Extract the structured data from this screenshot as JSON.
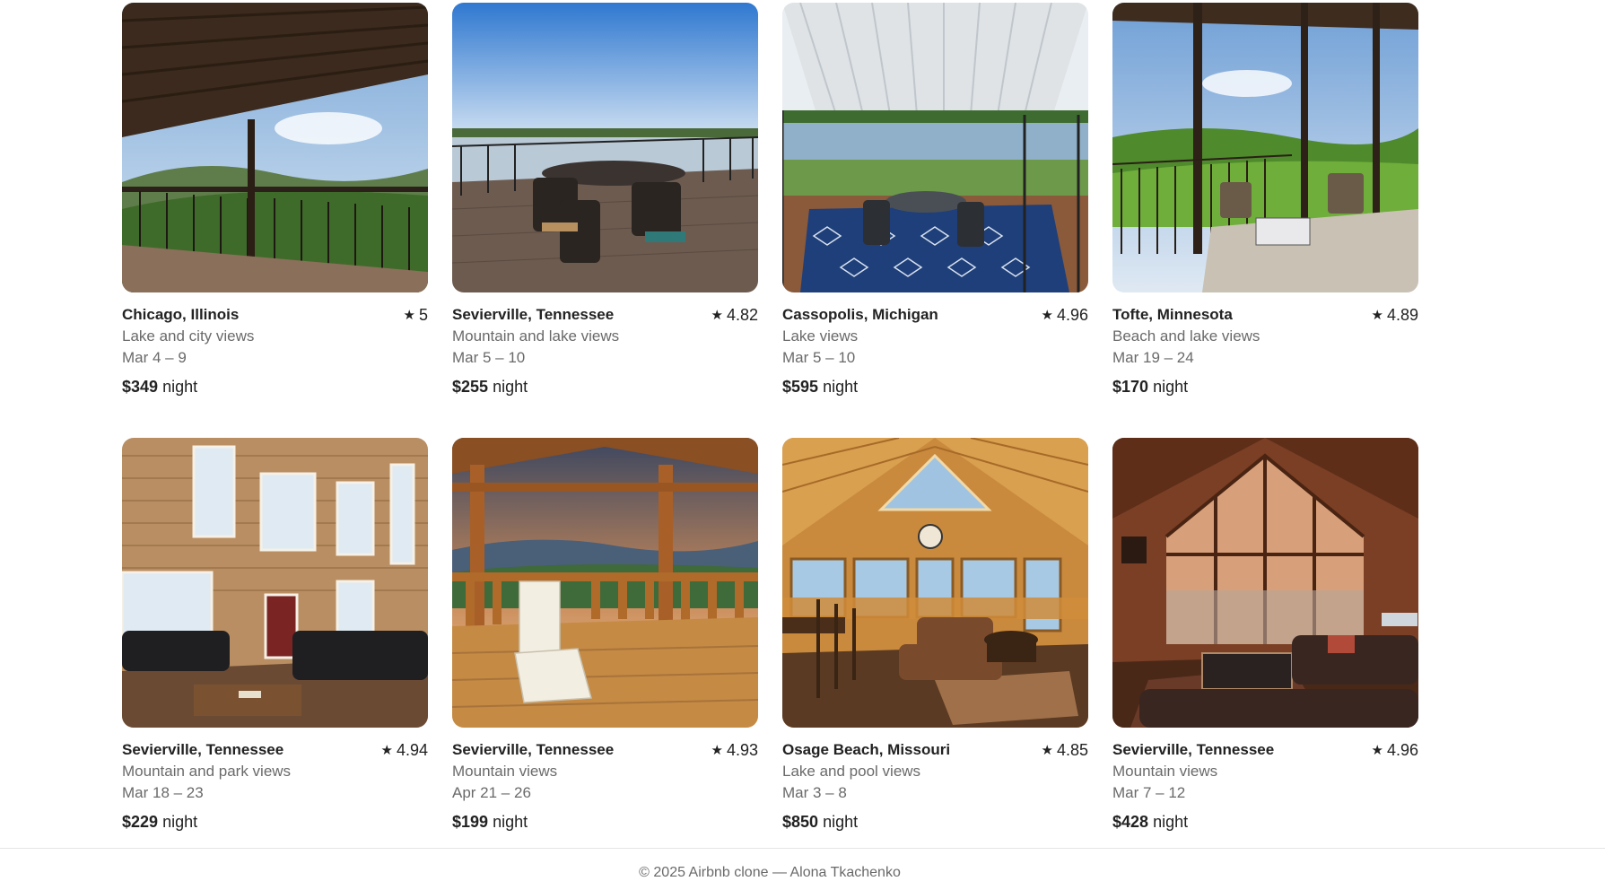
{
  "listings": [
    {
      "location": "Chicago, Illinois",
      "rating": "5",
      "subtitle": "Lake and city views",
      "dates": "Mar 4 – 9",
      "price": "$349",
      "unit": "night",
      "scene": "deck-mountain"
    },
    {
      "location": "Sevierville, Tennessee",
      "rating": "4.82",
      "subtitle": "Mountain and lake views",
      "dates": "Mar 5 – 10",
      "price": "$255",
      "unit": "night",
      "scene": "deck-lake"
    },
    {
      "location": "Cassopolis, Michigan",
      "rating": "4.96",
      "subtitle": "Lake views",
      "dates": "Mar 5 – 10",
      "price": "$595",
      "unit": "night",
      "scene": "porch-lake"
    },
    {
      "location": "Tofte, Minnesota",
      "rating": "4.89",
      "subtitle": "Beach and lake views",
      "dates": "Mar 19 – 24",
      "price": "$170",
      "unit": "night",
      "scene": "porch-forest"
    },
    {
      "location": "Sevierville, Tennessee",
      "rating": "4.94",
      "subtitle": "Mountain and park views",
      "dates": "Mar 18 – 23",
      "price": "$229",
      "unit": "night",
      "scene": "living-wood"
    },
    {
      "location": "Sevierville, Tennessee",
      "rating": "4.93",
      "subtitle": "Mountain views",
      "dates": "Apr 21 – 26",
      "price": "$199",
      "unit": "night",
      "scene": "deck-sunset"
    },
    {
      "location": "Osage Beach, Missouri",
      "rating": "4.85",
      "subtitle": "Lake and pool views",
      "dates": "Mar 3 – 8",
      "price": "$850",
      "unit": "night",
      "scene": "cabin-great-room"
    },
    {
      "location": "Sevierville, Tennessee",
      "rating": "4.96",
      "subtitle": "Mountain views",
      "dates": "Mar 7 – 12",
      "price": "$428",
      "unit": "night",
      "scene": "cabin-living"
    }
  ],
  "footer": {
    "text": "© 2025 Airbnb clone — Alona Tkachenko"
  },
  "icons": {
    "rating": "star-icon"
  },
  "colors": {
    "text": "#222222",
    "muted": "#6a6a6a"
  }
}
